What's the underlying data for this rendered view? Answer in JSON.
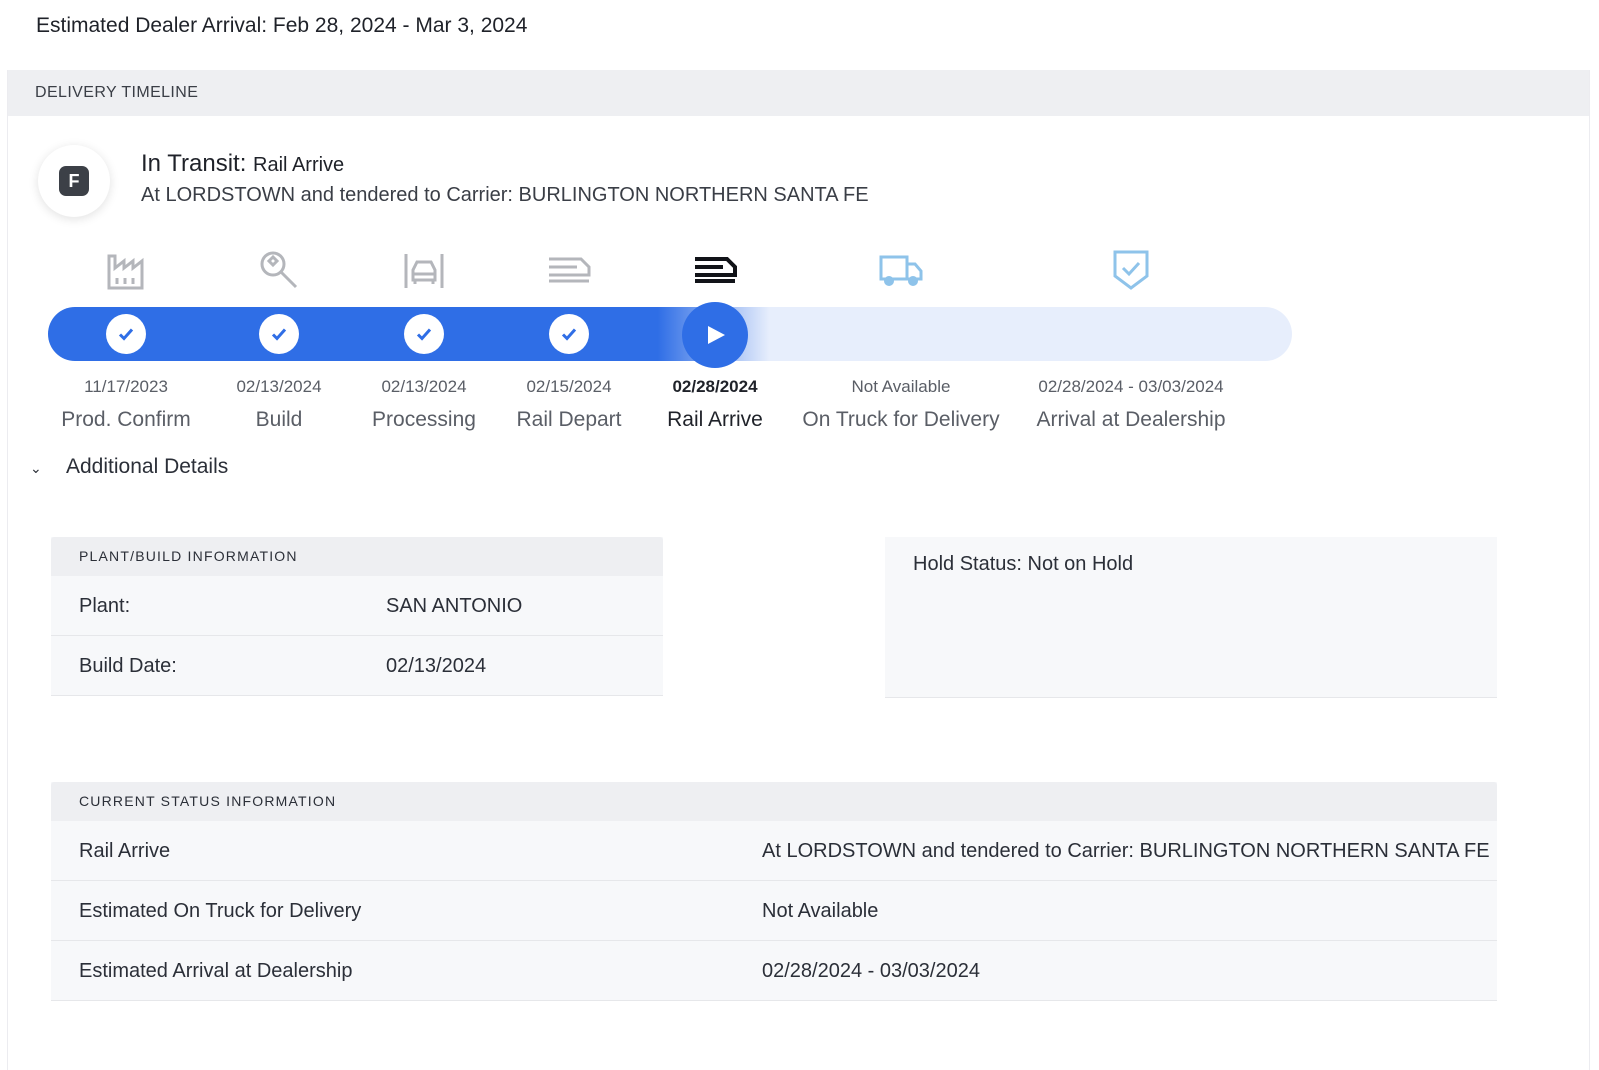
{
  "eta_text": "Estimated Dealer Arrival: Feb 28, 2024 - Mar 3, 2024",
  "card_title": "DELIVERY TIMELINE",
  "status": {
    "avatar_letter": "F",
    "title": "In Transit:",
    "subtitle": "Rail Arrive",
    "description": "At LORDSTOWN and tendered to Carrier: BURLINGTON NORTHERN SANTA FE"
  },
  "timeline": {
    "progress_fraction": 0.56,
    "active_color": "#2f6ee6",
    "inactive_color": "#e7eefc",
    "steps": [
      {
        "icon": "factory-icon",
        "date": "11/17/2023",
        "label": "Prod. Confirm",
        "state": "complete"
      },
      {
        "icon": "wrench-icon",
        "date": "02/13/2024",
        "label": "Build",
        "state": "complete"
      },
      {
        "icon": "vehicle-front-icon",
        "date": "02/13/2024",
        "label": "Processing",
        "state": "complete"
      },
      {
        "icon": "train-icon",
        "date": "02/15/2024",
        "label": "Rail Depart",
        "state": "complete"
      },
      {
        "icon": "train-icon",
        "date": "02/28/2024",
        "label": "Rail Arrive",
        "state": "current"
      },
      {
        "icon": "truck-icon",
        "date": "Not Available",
        "label": "On Truck for Delivery",
        "state": "pending"
      },
      {
        "icon": "shield-check-icon",
        "date": "02/28/2024 - 03/03/2024",
        "label": "Arrival at Dealership",
        "state": "pending"
      }
    ]
  },
  "additional_details": {
    "label": "Additional Details",
    "plant_panel": {
      "title": "PLANT/BUILD INFORMATION",
      "rows": [
        {
          "key": "Plant:",
          "value": "SAN ANTONIO"
        },
        {
          "key": "Build Date:",
          "value": "02/13/2024"
        }
      ]
    },
    "hold_status": "Hold Status: Not on Hold",
    "current_status_panel": {
      "title": "CURRENT STATUS INFORMATION",
      "rows": [
        {
          "key": "Rail Arrive",
          "value": "At LORDSTOWN and tendered to Carrier: BURLINGTON NORTHERN SANTA FE"
        },
        {
          "key": "Estimated On Truck for Delivery",
          "value": "Not Available"
        },
        {
          "key": "Estimated Arrival at Dealership",
          "value": "02/28/2024 - 03/03/2024"
        }
      ]
    }
  }
}
